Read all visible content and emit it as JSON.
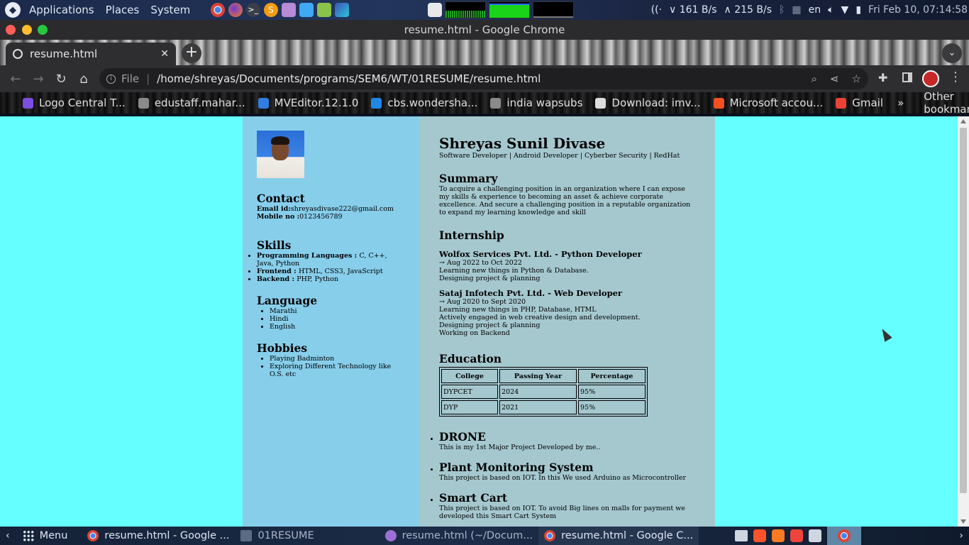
{
  "system_panel": {
    "menus": [
      "Applications",
      "Places",
      "System"
    ],
    "net_down": "161 B/s",
    "net_up": "215 B/s",
    "keyboard_layout": "en",
    "clock": "Fri Feb 10, 07:14:58"
  },
  "window": {
    "title": "resume.html - Google Chrome"
  },
  "tab": {
    "title": "resume.html"
  },
  "omnibox": {
    "scheme": "File",
    "path": "/home/shreyas/Documents/programs/SEM6/WT/01RESUME/resume.html"
  },
  "bookmarks": [
    {
      "label": "Logo Central T...",
      "color": "#7b4de0"
    },
    {
      "label": "edustaff.mahar...",
      "color": "#8a8a8a"
    },
    {
      "label": "MVEditor.12.1.0",
      "color": "#2f7de1"
    },
    {
      "label": "cbs.wondersha...",
      "color": "#1e88e5"
    },
    {
      "label": "india wapsubs",
      "color": "#8a8a8a"
    },
    {
      "label": "Download: imv...",
      "color": "#dddddd"
    },
    {
      "label": "Microsoft accou...",
      "color": "#f25022"
    },
    {
      "label": "Gmail",
      "color": "#ea4335"
    }
  ],
  "bookmarks_more": "»",
  "bookmarks_other": "Other bookmarks",
  "resume": {
    "sidebar": {
      "contact": {
        "heading": "Contact",
        "email_label": "Email id:",
        "email": "shreyasdivase222@gmail.com",
        "mobile_label": "Mobile no :",
        "mobile": "0123456789"
      },
      "skills": {
        "heading": "Skills",
        "items": [
          {
            "label": "Programming Languages : ",
            "value": "C, C++, Java, Python"
          },
          {
            "label": "Frontend : ",
            "value": "HTML, CSS3, JavaScript"
          },
          {
            "label": "Backend : ",
            "value": "PHP, Python"
          }
        ]
      },
      "language": {
        "heading": "Language",
        "items": [
          "Marathi",
          "Hindi",
          "English"
        ]
      },
      "hobbies": {
        "heading": "Hobbies",
        "items": [
          "Playing Badminton",
          "Exploring Different Technology like O.S. etc"
        ]
      }
    },
    "main": {
      "name": "Shreyas Sunil Divase",
      "tagline": "Software Developer | Android Developer | Cyberber Security | RedHat",
      "summary": {
        "heading": "Summary",
        "text": "To acquire a challenging position in an organization where I can expose my skills & experience to becoming an asset & achieve corporate excellence. And secure a challenging position in a reputable organization to expand my learning knowledge and skill"
      },
      "internship": {
        "heading": "Internship",
        "jobs": [
          {
            "title": "Wolfox Services Pvt. Ltd. - Python Developer",
            "dates": "→ Aug 2022 to Oct 2022",
            "points": [
              "Learning new things in Python & Database.",
              "Designing project & planning"
            ]
          },
          {
            "title": "Sataj Infotech Pvt. Ltd. - Web Developer",
            "dates": "→ Aug 2020 to Sept 2020",
            "points": [
              "Learning new things in PHP, Database, HTML",
              "Actively engaged in web creative design and development.",
              "Designing project & planning",
              "Working on Backend"
            ]
          }
        ]
      },
      "education": {
        "heading": "Education",
        "columns": [
          "College",
          "Passing Year",
          "Percentage"
        ],
        "rows": [
          [
            "DYPCET",
            "2024",
            "95%"
          ],
          [
            "DYP",
            "2021",
            "95%"
          ]
        ]
      },
      "projects": [
        {
          "title": "DRONE",
          "desc": "This is my 1st Major Project Developed by me.."
        },
        {
          "title": "Plant Monitoring System",
          "desc": "This project is based on IOT. In this We used Arduino as Microcontroller"
        },
        {
          "title": "Smart Cart",
          "desc": "This project is based on IOT. To avoid Big lines on malls for payment we developed this Smart Cart System"
        }
      ]
    }
  },
  "taskbar": {
    "menu_label": "Menu",
    "tasks": [
      {
        "label": "resume.html - Google ...",
        "active": false
      },
      {
        "label": "01RESUME",
        "active": false
      },
      {
        "label": "resume.html (~/Docum...",
        "active": false
      },
      {
        "label": "resume.html - Google C...",
        "active": true
      }
    ]
  }
}
